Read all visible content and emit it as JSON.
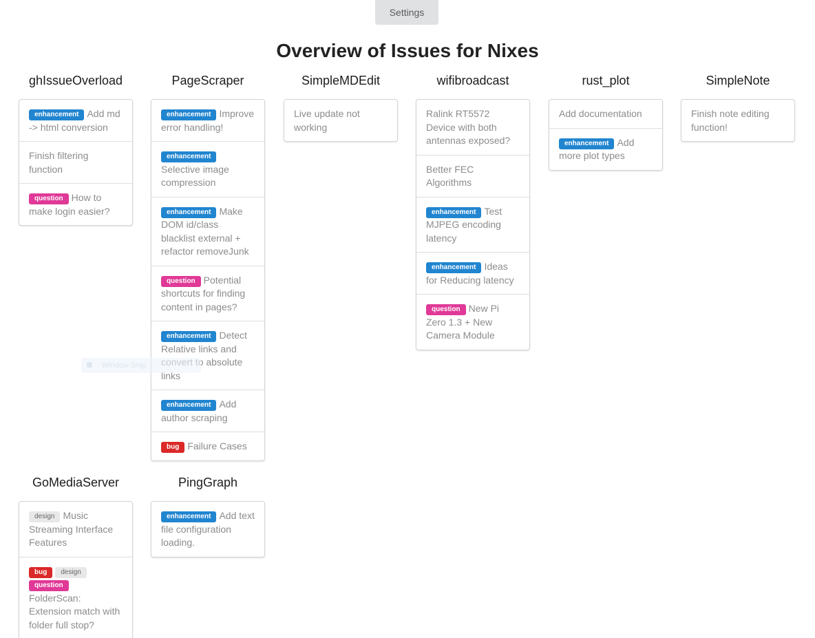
{
  "header": {
    "settings_label": "Settings",
    "page_title": "Overview of Issues for Nixes"
  },
  "overlay": {
    "toast_text": "Window Snip"
  },
  "repos": [
    {
      "name": "ghIssueOverload",
      "issues": [
        {
          "labels": [
            "enhancement"
          ],
          "title": "Add md -> html conversion"
        },
        {
          "labels": [],
          "title": "Finish filtering function"
        },
        {
          "labels": [
            "question"
          ],
          "title": "How to make login easier?"
        }
      ]
    },
    {
      "name": "PageScraper",
      "issues": [
        {
          "labels": [
            "enhancement"
          ],
          "title": "Improve error handling!"
        },
        {
          "labels": [
            "enhancement"
          ],
          "title": "Selective image compression"
        },
        {
          "labels": [
            "enhancement"
          ],
          "title": "Make DOM id/class blacklist external + refactor removeJunk"
        },
        {
          "labels": [
            "question"
          ],
          "title": "Potential shortcuts for finding content in pages?"
        },
        {
          "labels": [
            "enhancement"
          ],
          "title": "Detect Relative links and convert to absolute links"
        },
        {
          "labels": [
            "enhancement"
          ],
          "title": "Add author scraping"
        },
        {
          "labels": [
            "bug"
          ],
          "title": "Failure Cases"
        }
      ]
    },
    {
      "name": "SimpleMDEdit",
      "issues": [
        {
          "labels": [],
          "title": "Live update not working"
        }
      ]
    },
    {
      "name": "wifibroadcast",
      "issues": [
        {
          "labels": [],
          "title": "Ralink RT5572 Device with both antennas exposed?"
        },
        {
          "labels": [],
          "title": "Better FEC Algorithms"
        },
        {
          "labels": [
            "enhancement"
          ],
          "title": "Test MJPEG encoding latency"
        },
        {
          "labels": [
            "enhancement"
          ],
          "title": "Ideas for Reducing latency"
        },
        {
          "labels": [
            "question"
          ],
          "title": "New Pi Zero 1.3 + New Camera Module"
        }
      ]
    },
    {
      "name": "rust_plot",
      "issues": [
        {
          "labels": [],
          "title": "Add documentation"
        },
        {
          "labels": [
            "enhancement"
          ],
          "title": "Add more plot types"
        }
      ]
    },
    {
      "name": "SimpleNote",
      "issues": [
        {
          "labels": [],
          "title": "Finish note editing function!"
        }
      ]
    },
    {
      "name": "GoMediaServer",
      "issues": [
        {
          "labels": [
            "design"
          ],
          "title": "Music Streaming Interface Features"
        },
        {
          "labels": [
            "bug",
            "design",
            "question"
          ],
          "title": "FolderScan: Extension match with folder full stop?"
        }
      ]
    },
    {
      "name": "PingGraph",
      "issues": [
        {
          "labels": [
            "enhancement"
          ],
          "title": "Add text file configuration loading."
        }
      ]
    }
  ],
  "label_colors": {
    "enhancement": "#2185d0",
    "question": "#e03997",
    "bug": "#db2828",
    "design": "#e8e8e8"
  }
}
